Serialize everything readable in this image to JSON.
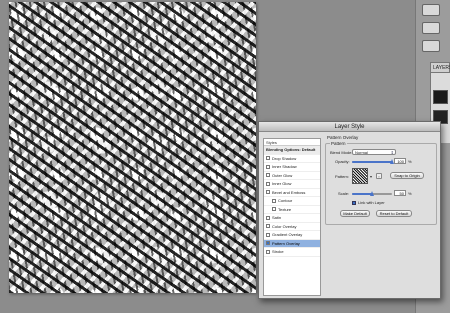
{
  "dialog": {
    "title": "Layer Style",
    "styles_header": "Styles",
    "blending_options": "Blending Options: Default",
    "styles": [
      {
        "label": "Drop Shadow",
        "checked": false,
        "sub": false
      },
      {
        "label": "Inner Shadow",
        "checked": false,
        "sub": false
      },
      {
        "label": "Outer Glow",
        "checked": false,
        "sub": false
      },
      {
        "label": "Inner Glow",
        "checked": false,
        "sub": false
      },
      {
        "label": "Bevel and Emboss",
        "checked": false,
        "sub": false
      },
      {
        "label": "Contour",
        "checked": false,
        "sub": true
      },
      {
        "label": "Texture",
        "checked": false,
        "sub": true
      },
      {
        "label": "Satin",
        "checked": false,
        "sub": false
      },
      {
        "label": "Color Overlay",
        "checked": false,
        "sub": false
      },
      {
        "label": "Gradient Overlay",
        "checked": false,
        "sub": false
      },
      {
        "label": "Pattern Overlay",
        "checked": true,
        "sub": false,
        "selected": true
      },
      {
        "label": "Stroke",
        "checked": false,
        "sub": false
      }
    ],
    "pattern_overlay": {
      "group_title": "Pattern Overlay",
      "fieldset_title": "Pattern",
      "blend_mode_label": "Blend Mode:",
      "blend_mode_value": "Normal",
      "opacity_label": "Opacity:",
      "opacity_value": "100",
      "opacity_unit": "%",
      "opacity_fraction": 1.0,
      "pattern_label": "Pattern:",
      "snap_button": "Snap to Origin",
      "scale_label": "Scale:",
      "scale_value": "50",
      "scale_unit": "%",
      "scale_fraction": 0.5,
      "link_label": "Link with Layer",
      "link_checked": true,
      "make_default": "Make Default",
      "reset_default": "Reset to Default"
    }
  },
  "panels": {
    "layers_tab": "LAYERS"
  },
  "colors": {
    "accent": "#4a74c9",
    "selection": "#8fb1e0",
    "dialog_bg": "#dedede",
    "workspace_bg": "#8c8c8c"
  }
}
